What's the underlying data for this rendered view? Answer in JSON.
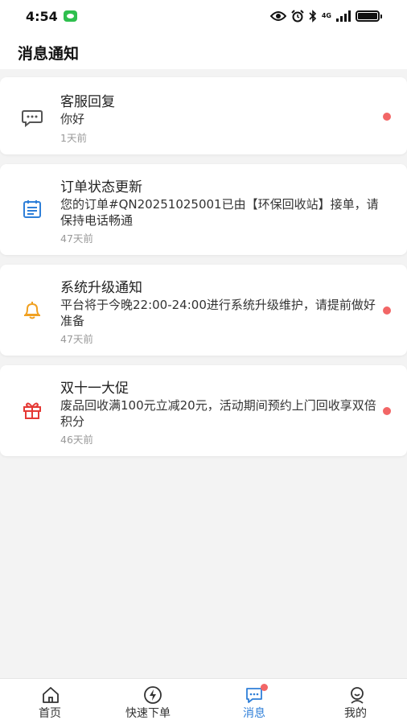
{
  "status_bar": {
    "time": "4:54",
    "network_label": "4G"
  },
  "header": {
    "title": "消息通知"
  },
  "messages": [
    {
      "icon": "chat-bubble-icon",
      "icon_color": "#555555",
      "title": "客服回复",
      "body": "你好",
      "time": "1天前",
      "unread": true
    },
    {
      "icon": "calendar-icon",
      "icon_color": "#2f7fd8",
      "title": "订单状态更新",
      "body": "您的订单#QN20251025001已由【环保回收站】接单，请保持电话畅通",
      "time": "47天前",
      "unread": false
    },
    {
      "icon": "bell-icon",
      "icon_color": "#f0a020",
      "title": "系统升级通知",
      "body": "平台将于今晚22:00-24:00进行系统升级维护，请提前做好准备",
      "time": "47天前",
      "unread": true
    },
    {
      "icon": "gift-icon",
      "icon_color": "#e53935",
      "title": "双十一大促",
      "body": "废品回收满100元立减20元，活动期间预约上门回收享双倍积分",
      "time": "46天前",
      "unread": true
    }
  ],
  "tabs": [
    {
      "icon": "home-icon",
      "label": "首页",
      "active": false
    },
    {
      "icon": "lightning-icon",
      "label": "快速下单",
      "active": false
    },
    {
      "icon": "message-icon",
      "label": "消息",
      "active": true,
      "badge": true
    },
    {
      "icon": "user-icon",
      "label": "我的",
      "active": false
    }
  ],
  "colors": {
    "accent": "#2f7fd8",
    "unread_dot": "#f26666",
    "background": "#f3f3f3"
  }
}
